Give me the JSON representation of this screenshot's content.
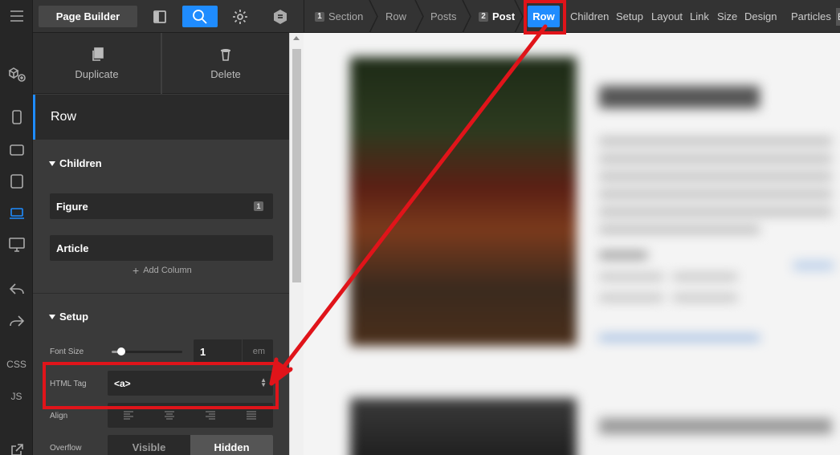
{
  "app": {
    "builder_title": "Page Builder"
  },
  "rail": {
    "css_label": "CSS",
    "js_label": "JS"
  },
  "breadcrumb": {
    "items": [
      {
        "num": "1",
        "label": "Section"
      },
      {
        "num": "",
        "label": "Row"
      },
      {
        "num": "",
        "label": "Posts"
      },
      {
        "num": "2",
        "label": "Post"
      }
    ],
    "active": "Row"
  },
  "tabs": [
    "Children",
    "Setup",
    "Layout",
    "Link",
    "Size",
    "Design",
    "Particles"
  ],
  "tab_more": "E",
  "actions": {
    "duplicate": "Duplicate",
    "delete": "Delete"
  },
  "element": {
    "title": "Row"
  },
  "children_section": {
    "title": "Children",
    "items": [
      {
        "label": "Figure",
        "badge": "1"
      },
      {
        "label": "Article",
        "badge": ""
      }
    ],
    "add_column": "Add Column"
  },
  "setup_section": {
    "title": "Setup",
    "font_size": {
      "label": "Font Size",
      "value": "1",
      "unit": "em",
      "slider_fraction": 0.1
    },
    "html_tag": {
      "label": "HTML Tag",
      "value": "<a>"
    },
    "align": {
      "label": "Align"
    },
    "overflow": {
      "label": "Overflow",
      "options": [
        "Visible",
        "Hidden"
      ],
      "selected": "Hidden"
    }
  },
  "annotation": {
    "color": "#e0141a"
  },
  "colors": {
    "accent": "#1f8cff"
  }
}
